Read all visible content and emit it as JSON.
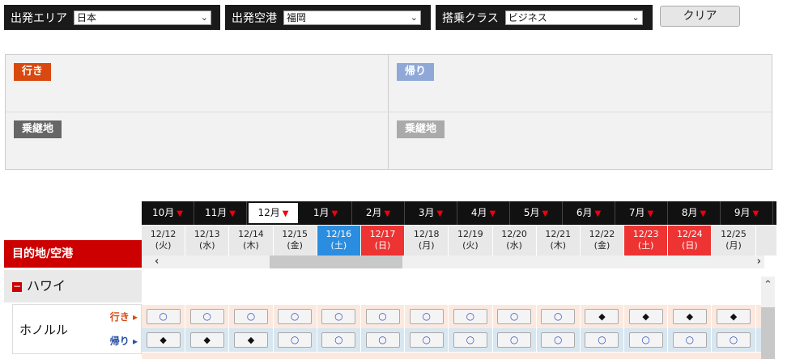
{
  "filters": {
    "area": {
      "label": "出発エリア",
      "value": "日本"
    },
    "airport": {
      "label": "出発空港",
      "value": "福岡"
    },
    "class": {
      "label": "搭乗クラス",
      "value": "ビジネス"
    },
    "clear_label": "クリア"
  },
  "panel": {
    "outbound_label": "行き",
    "return_label": "帰り",
    "transfer_out_label": "乗継地",
    "transfer_ret_label": "乗継地"
  },
  "months": [
    "10月",
    "11月",
    "12月",
    "1月",
    "2月",
    "3月",
    "4月",
    "5月",
    "6月",
    "7月",
    "8月",
    "9月"
  ],
  "active_month": "12月",
  "dates": [
    {
      "date": "12/12",
      "dow": "(火)",
      "kind": "normal"
    },
    {
      "date": "12/13",
      "dow": "(水)",
      "kind": "normal"
    },
    {
      "date": "12/14",
      "dow": "(木)",
      "kind": "normal"
    },
    {
      "date": "12/15",
      "dow": "(金)",
      "kind": "normal"
    },
    {
      "date": "12/16",
      "dow": "(土)",
      "kind": "sat"
    },
    {
      "date": "12/17",
      "dow": "(日)",
      "kind": "hol"
    },
    {
      "date": "12/18",
      "dow": "(月)",
      "kind": "normal"
    },
    {
      "date": "12/19",
      "dow": "(火)",
      "kind": "normal"
    },
    {
      "date": "12/20",
      "dow": "(水)",
      "kind": "normal"
    },
    {
      "date": "12/21",
      "dow": "(木)",
      "kind": "normal"
    },
    {
      "date": "12/22",
      "dow": "(金)",
      "kind": "normal"
    },
    {
      "date": "12/23",
      "dow": "(土)",
      "kind": "hol"
    },
    {
      "date": "12/24",
      "dow": "(日)",
      "kind": "hol"
    },
    {
      "date": "12/25",
      "dow": "(月)",
      "kind": "normal"
    }
  ],
  "destination_header": "目的地/空港",
  "region": "ハワイ",
  "city": "ホノルル",
  "outbound_dir": "行き ▸",
  "return_dir": "帰り ▸",
  "outbound_marks": [
    "○",
    "○",
    "○",
    "○",
    "○",
    "○",
    "○",
    "○",
    "○",
    "○",
    "◆",
    "◆",
    "◆",
    "◆"
  ],
  "return_marks": [
    "◆",
    "◆",
    "◆",
    "○",
    "○",
    "○",
    "○",
    "○",
    "○",
    "○",
    "○",
    "○",
    "○",
    "○"
  ],
  "colors": {
    "accent_red": "#cc0000",
    "outbound": "#d9480f",
    "return": "#8fa8d8",
    "transfer": "#666666",
    "saturday": "#2b8de0",
    "holiday": "#e33333"
  }
}
